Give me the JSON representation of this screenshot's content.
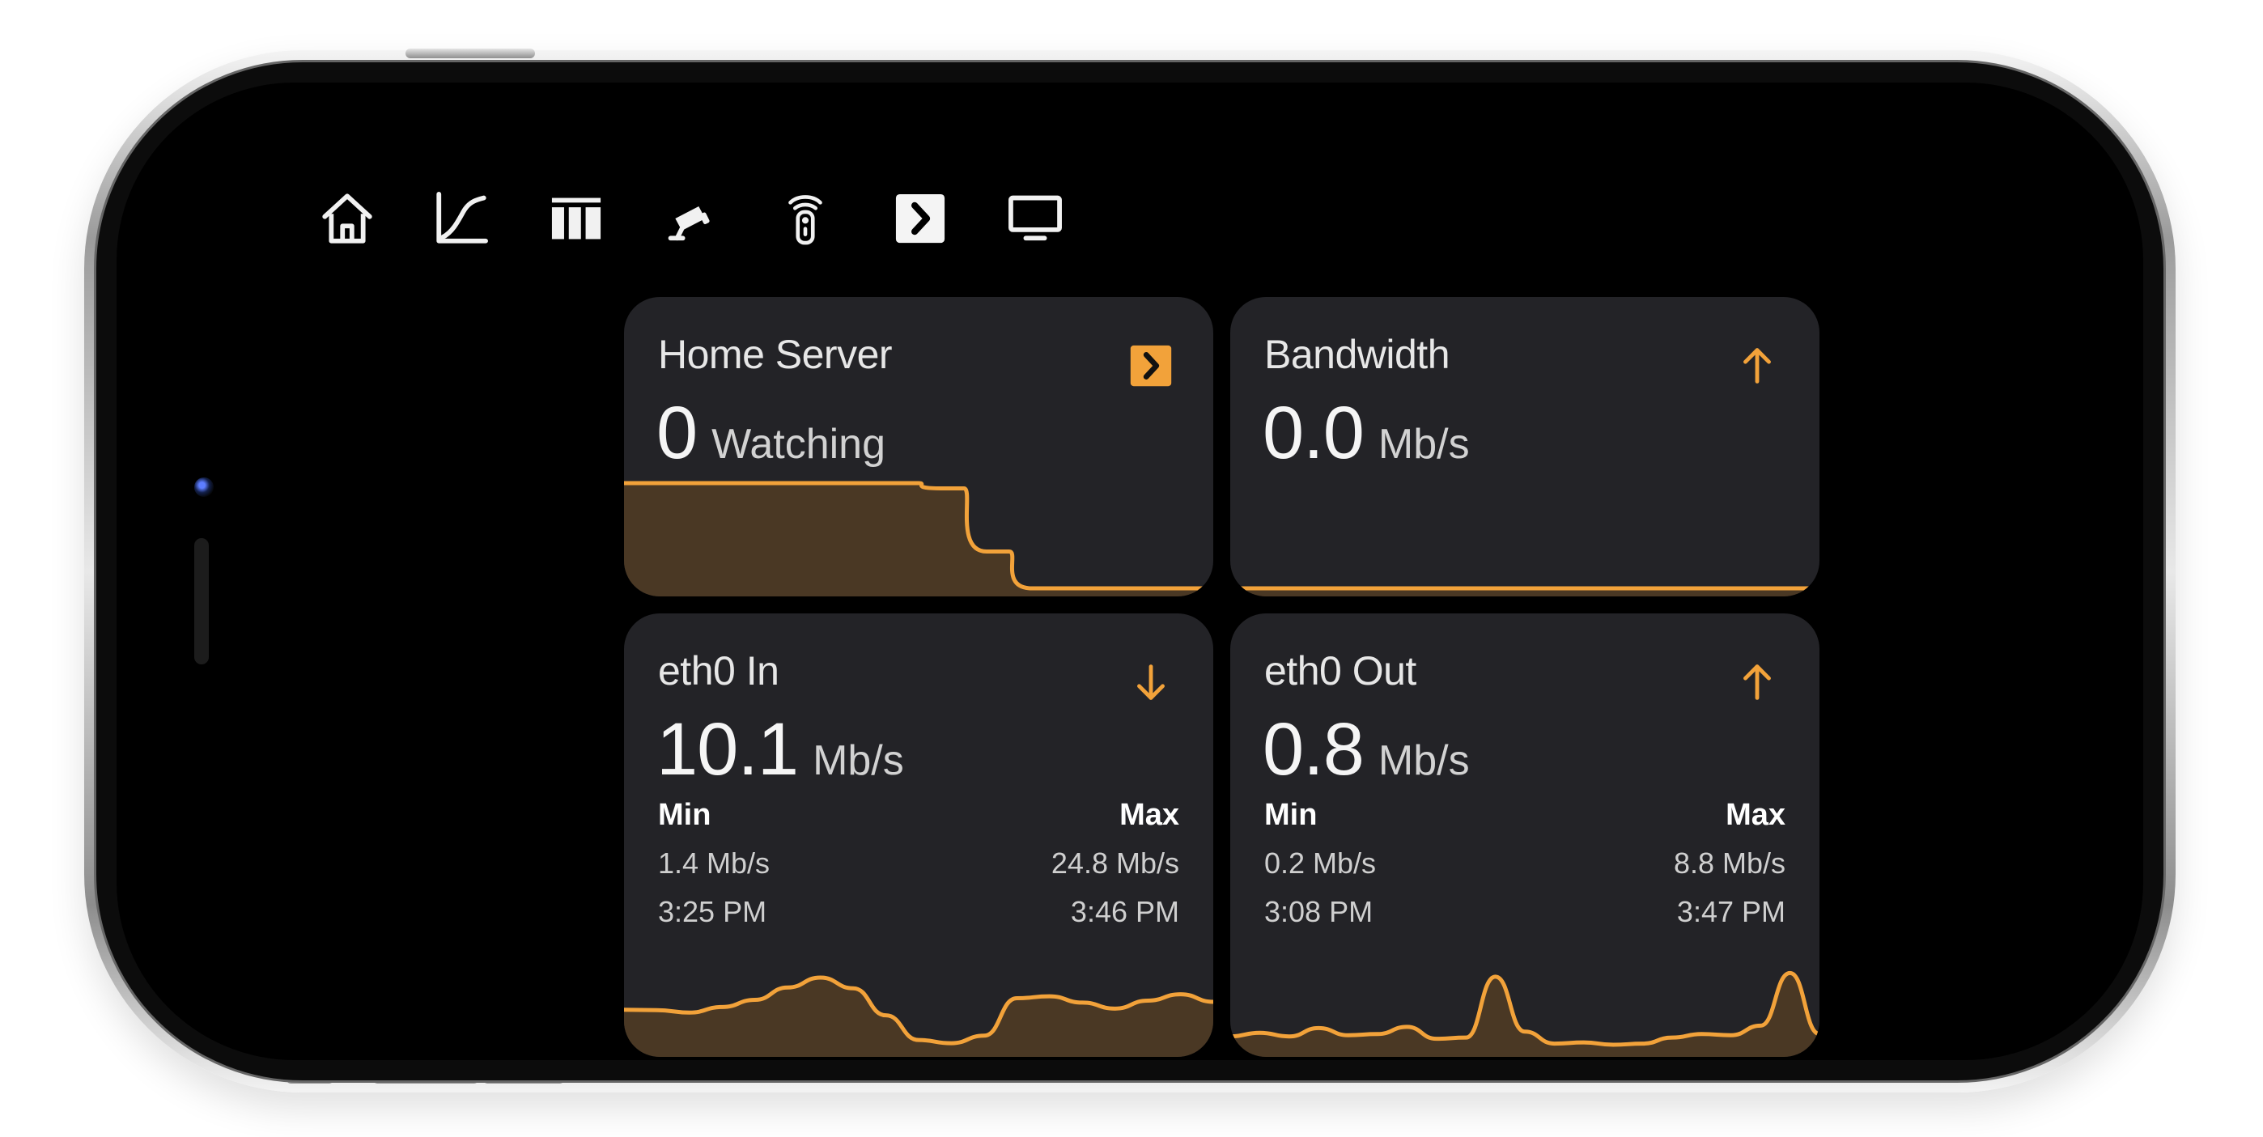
{
  "app": {
    "accent": "#F2A23A",
    "background": "#000000",
    "card_background": "#232327"
  },
  "nav": {
    "items": [
      {
        "name": "home-icon",
        "active": false
      },
      {
        "name": "chart-icon",
        "active": false
      },
      {
        "name": "columns-icon",
        "active": false
      },
      {
        "name": "camera-icon",
        "active": false
      },
      {
        "name": "remote-icon",
        "active": false
      },
      {
        "name": "plex-icon",
        "active": true
      },
      {
        "name": "tv-icon",
        "active": false
      }
    ]
  },
  "cards": {
    "home_server": {
      "title": "Home Server",
      "value": "0",
      "unit": "Watching",
      "icon": "plex-icon",
      "chart_data": {
        "type": "area",
        "series": [
          {
            "name": "",
            "values": [
              1,
              1,
              1,
              1,
              1,
              1,
              1,
              0.95,
              0.35,
              0,
              0,
              0,
              0,
              0
            ]
          }
        ]
      }
    },
    "bandwidth": {
      "title": "Bandwidth",
      "value": "0.0",
      "unit": "Mb/s",
      "icon": "arrow-up-icon",
      "chart_data": {
        "type": "area",
        "series": [
          {
            "name": "",
            "values": [
              0,
              0,
              0,
              0,
              0,
              0,
              0,
              0,
              0,
              0,
              0,
              0
            ]
          }
        ]
      }
    },
    "eth0_in": {
      "title": "eth0 In",
      "value": "10.1",
      "unit": "Mb/s",
      "icon": "arrow-down-icon",
      "min_label": "Min",
      "max_label": "Max",
      "min_value": "1.4 Mb/s",
      "max_value": "24.8 Mb/s",
      "min_time": "3:25 PM",
      "max_time": "3:46 PM",
      "chart_data": {
        "type": "area",
        "series": [
          {
            "name": "",
            "values": [
              9.8,
              9.7,
              9.1,
              10.5,
              12.3,
              15.4,
              17.9,
              15.2,
              8.4,
              2.2,
              1.4,
              3.3,
              12.7,
              13.2,
              11.6,
              10.1,
              12.1,
              13.7,
              11.8
            ]
          }
        ]
      }
    },
    "eth0_out": {
      "title": "eth0 Out",
      "value": "0.8",
      "unit": "Mb/s",
      "icon": "arrow-up-icon",
      "min_label": "Min",
      "max_label": "Max",
      "min_value": "0.2 Mb/s",
      "max_value": "8.8 Mb/s",
      "min_time": "3:08 PM",
      "max_time": "3:47 PM",
      "chart_data": {
        "type": "area",
        "series": [
          {
            "name": "",
            "values": [
              0.9,
              1.2,
              0.9,
              1.6,
              1.0,
              1.1,
              1.7,
              0.7,
              0.8,
              5.9,
              1.3,
              0.3,
              0.4,
              0.2,
              0.3,
              0.8,
              1.1,
              1.0,
              1.8,
              6.2,
              1.1
            ]
          }
        ]
      }
    }
  }
}
